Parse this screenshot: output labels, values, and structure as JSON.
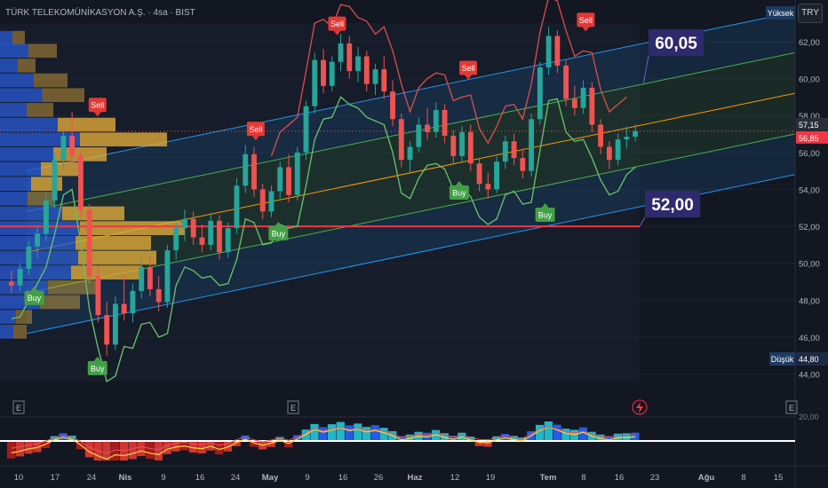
{
  "header": {
    "symbol_title": "TÜRK TELEKOMÜNİKASYON A.Ş. · 4sa · BIST",
    "currency_button": "TRY"
  },
  "colors": {
    "background": "#131722",
    "up": "#26a69a",
    "down": "#ef5350",
    "channel_outer": "#2196f3",
    "channel_inner": "#4caf50",
    "channel_mid": "#ff9800",
    "profile_bar": "#e0a93a",
    "profile_blue": "#2a5bd7",
    "callout_bg": "#2f2a6e",
    "level_line": "#f23645"
  },
  "chart_data": {
    "type": "candlestick",
    "y_axis": {
      "ylim": [
        43.6,
        63.0
      ],
      "ticks": [
        62,
        60,
        58,
        56,
        54,
        52,
        50,
        48,
        46,
        44
      ],
      "tick_labels": [
        "62,00",
        "60,00",
        "58,00",
        "56,00",
        "54,00",
        "52,00",
        "50,00",
        "48,00",
        "46,00",
        "44,00"
      ],
      "lower_panel_tick": "20,00"
    },
    "x_axis": {
      "tick_labels": [
        "10",
        "17",
        "24",
        "Nis",
        "9",
        "16",
        "24",
        "May",
        "9",
        "16",
        "26",
        "Haz",
        "12",
        "19",
        "Tem",
        "8",
        "16",
        "23",
        "Ağu",
        "8",
        "15"
      ]
    },
    "price_labels": {
      "high_label": "Yüksek",
      "high_value": "62,80",
      "low_label": "Düşük",
      "low_value": "44,80",
      "last": "57,15",
      "prev": "56,85"
    },
    "callouts": [
      {
        "text": "60,05",
        "price": 60.05
      },
      {
        "text": "52,00",
        "price": 52.0
      }
    ],
    "horizontal_level": 52.0,
    "signals": [
      {
        "label": "Buy",
        "type": "buy",
        "date": "2024-03-10",
        "price": 48.8
      },
      {
        "label": "Buy",
        "type": "buy",
        "date": "2024-03-24",
        "price": 45.0
      },
      {
        "label": "Sell",
        "type": "sell",
        "date": "2024-03-24",
        "price": 57.9
      },
      {
        "label": "Buy",
        "type": "buy",
        "date": "2024-05-03",
        "price": 52.3
      },
      {
        "label": "Sell",
        "type": "sell",
        "date": "2024-04-28",
        "price": 56.6
      },
      {
        "label": "Sell",
        "type": "sell",
        "date": "2024-05-16",
        "price": 62.3
      },
      {
        "label": "Buy",
        "type": "buy",
        "date": "2024-06-12",
        "price": 54.5
      },
      {
        "label": "Sell",
        "type": "sell",
        "date": "2024-06-14",
        "price": 59.9
      },
      {
        "label": "Buy",
        "type": "buy",
        "date": "2024-07-01",
        "price": 53.3
      },
      {
        "label": "Sell",
        "type": "sell",
        "date": "2024-07-10",
        "price": 62.5
      }
    ],
    "candles": [
      {
        "o": 49.0,
        "h": 49.6,
        "l": 48.4,
        "c": 48.8
      },
      {
        "o": 48.8,
        "h": 50.0,
        "l": 48.5,
        "c": 49.7
      },
      {
        "o": 49.7,
        "h": 51.2,
        "l": 49.4,
        "c": 50.9
      },
      {
        "o": 50.9,
        "h": 52.0,
        "l": 50.3,
        "c": 51.6
      },
      {
        "o": 51.6,
        "h": 53.8,
        "l": 51.2,
        "c": 53.4
      },
      {
        "o": 53.4,
        "h": 56.0,
        "l": 53.0,
        "c": 55.6
      },
      {
        "o": 55.6,
        "h": 57.2,
        "l": 55.1,
        "c": 56.9
      },
      {
        "o": 56.9,
        "h": 58.2,
        "l": 55.4,
        "c": 55.8
      },
      {
        "o": 55.8,
        "h": 56.1,
        "l": 52.5,
        "c": 52.9
      },
      {
        "o": 52.9,
        "h": 53.2,
        "l": 48.9,
        "c": 49.3
      },
      {
        "o": 49.3,
        "h": 49.8,
        "l": 46.8,
        "c": 47.2
      },
      {
        "o": 47.2,
        "h": 47.9,
        "l": 45.0,
        "c": 45.6
      },
      {
        "o": 45.6,
        "h": 48.2,
        "l": 45.3,
        "c": 47.8
      },
      {
        "o": 47.8,
        "h": 49.4,
        "l": 46.9,
        "c": 47.3
      },
      {
        "o": 47.3,
        "h": 48.9,
        "l": 46.8,
        "c": 48.5
      },
      {
        "o": 48.5,
        "h": 50.2,
        "l": 48.1,
        "c": 49.8
      },
      {
        "o": 49.8,
        "h": 50.4,
        "l": 48.2,
        "c": 48.6
      },
      {
        "o": 48.6,
        "h": 49.3,
        "l": 47.4,
        "c": 47.9
      },
      {
        "o": 47.9,
        "h": 51.0,
        "l": 47.6,
        "c": 50.7
      },
      {
        "o": 50.7,
        "h": 52.2,
        "l": 50.2,
        "c": 51.9
      },
      {
        "o": 51.9,
        "h": 52.9,
        "l": 51.2,
        "c": 52.4
      },
      {
        "o": 52.4,
        "h": 52.8,
        "l": 51.0,
        "c": 51.4
      },
      {
        "o": 51.4,
        "h": 52.1,
        "l": 50.6,
        "c": 51.0
      },
      {
        "o": 51.0,
        "h": 52.7,
        "l": 50.7,
        "c": 52.3
      },
      {
        "o": 52.3,
        "h": 52.6,
        "l": 50.2,
        "c": 50.6
      },
      {
        "o": 50.6,
        "h": 52.2,
        "l": 50.3,
        "c": 51.9
      },
      {
        "o": 51.9,
        "h": 54.6,
        "l": 51.6,
        "c": 54.2
      },
      {
        "o": 54.2,
        "h": 56.4,
        "l": 53.8,
        "c": 55.9
      },
      {
        "o": 55.9,
        "h": 56.3,
        "l": 53.6,
        "c": 54.0
      },
      {
        "o": 54.0,
        "h": 54.3,
        "l": 52.4,
        "c": 52.8
      },
      {
        "o": 52.8,
        "h": 54.2,
        "l": 52.5,
        "c": 53.9
      },
      {
        "o": 53.9,
        "h": 55.5,
        "l": 53.5,
        "c": 55.2
      },
      {
        "o": 55.2,
        "h": 55.9,
        "l": 53.3,
        "c": 53.7
      },
      {
        "o": 53.7,
        "h": 56.3,
        "l": 53.4,
        "c": 56.0
      },
      {
        "o": 56.0,
        "h": 58.8,
        "l": 55.6,
        "c": 58.5
      },
      {
        "o": 58.5,
        "h": 61.4,
        "l": 58.1,
        "c": 61.0
      },
      {
        "o": 61.0,
        "h": 61.6,
        "l": 59.2,
        "c": 59.6
      },
      {
        "o": 59.6,
        "h": 61.2,
        "l": 59.3,
        "c": 60.9
      },
      {
        "o": 60.9,
        "h": 62.4,
        "l": 60.4,
        "c": 61.9
      },
      {
        "o": 61.9,
        "h": 62.3,
        "l": 60.0,
        "c": 60.4
      },
      {
        "o": 60.4,
        "h": 61.7,
        "l": 59.8,
        "c": 61.2
      },
      {
        "o": 61.2,
        "h": 61.5,
        "l": 59.3,
        "c": 59.7
      },
      {
        "o": 59.7,
        "h": 60.8,
        "l": 59.1,
        "c": 60.5
      },
      {
        "o": 60.5,
        "h": 61.2,
        "l": 58.9,
        "c": 59.3
      },
      {
        "o": 59.3,
        "h": 59.9,
        "l": 57.4,
        "c": 57.8
      },
      {
        "o": 57.8,
        "h": 58.1,
        "l": 55.2,
        "c": 55.6
      },
      {
        "o": 55.6,
        "h": 56.6,
        "l": 54.9,
        "c": 56.3
      },
      {
        "o": 56.3,
        "h": 57.9,
        "l": 56.0,
        "c": 57.5
      },
      {
        "o": 57.5,
        "h": 58.4,
        "l": 56.7,
        "c": 57.1
      },
      {
        "o": 57.1,
        "h": 58.7,
        "l": 56.8,
        "c": 58.3
      },
      {
        "o": 58.3,
        "h": 58.6,
        "l": 56.5,
        "c": 56.9
      },
      {
        "o": 56.9,
        "h": 57.2,
        "l": 55.4,
        "c": 55.8
      },
      {
        "o": 55.8,
        "h": 57.4,
        "l": 55.5,
        "c": 57.1
      },
      {
        "o": 57.1,
        "h": 57.5,
        "l": 55.0,
        "c": 55.4
      },
      {
        "o": 55.4,
        "h": 55.7,
        "l": 53.9,
        "c": 54.3
      },
      {
        "o": 54.3,
        "h": 54.9,
        "l": 53.5,
        "c": 54.0
      },
      {
        "o": 54.0,
        "h": 55.8,
        "l": 53.8,
        "c": 55.5
      },
      {
        "o": 55.5,
        "h": 56.9,
        "l": 55.1,
        "c": 56.6
      },
      {
        "o": 56.6,
        "h": 57.0,
        "l": 55.3,
        "c": 55.7
      },
      {
        "o": 55.7,
        "h": 56.2,
        "l": 54.6,
        "c": 55.0
      },
      {
        "o": 55.0,
        "h": 58.1,
        "l": 54.7,
        "c": 57.8
      },
      {
        "o": 57.8,
        "h": 60.9,
        "l": 57.5,
        "c": 60.6
      },
      {
        "o": 60.6,
        "h": 62.8,
        "l": 60.2,
        "c": 62.3
      },
      {
        "o": 62.3,
        "h": 62.6,
        "l": 60.3,
        "c": 60.7
      },
      {
        "o": 60.7,
        "h": 61.0,
        "l": 58.5,
        "c": 58.9
      },
      {
        "o": 58.9,
        "h": 59.6,
        "l": 58.0,
        "c": 58.4
      },
      {
        "o": 58.4,
        "h": 59.9,
        "l": 58.1,
        "c": 59.5
      },
      {
        "o": 59.5,
        "h": 59.8,
        "l": 57.1,
        "c": 57.5
      },
      {
        "o": 57.5,
        "h": 57.8,
        "l": 55.9,
        "c": 56.3
      },
      {
        "o": 56.3,
        "h": 56.6,
        "l": 55.1,
        "c": 55.6
      },
      {
        "o": 55.6,
        "h": 57.0,
        "l": 55.3,
        "c": 56.7
      },
      {
        "o": 56.7,
        "h": 57.4,
        "l": 56.2,
        "c": 56.85
      },
      {
        "o": 56.85,
        "h": 57.5,
        "l": 56.6,
        "c": 57.15
      }
    ]
  }
}
